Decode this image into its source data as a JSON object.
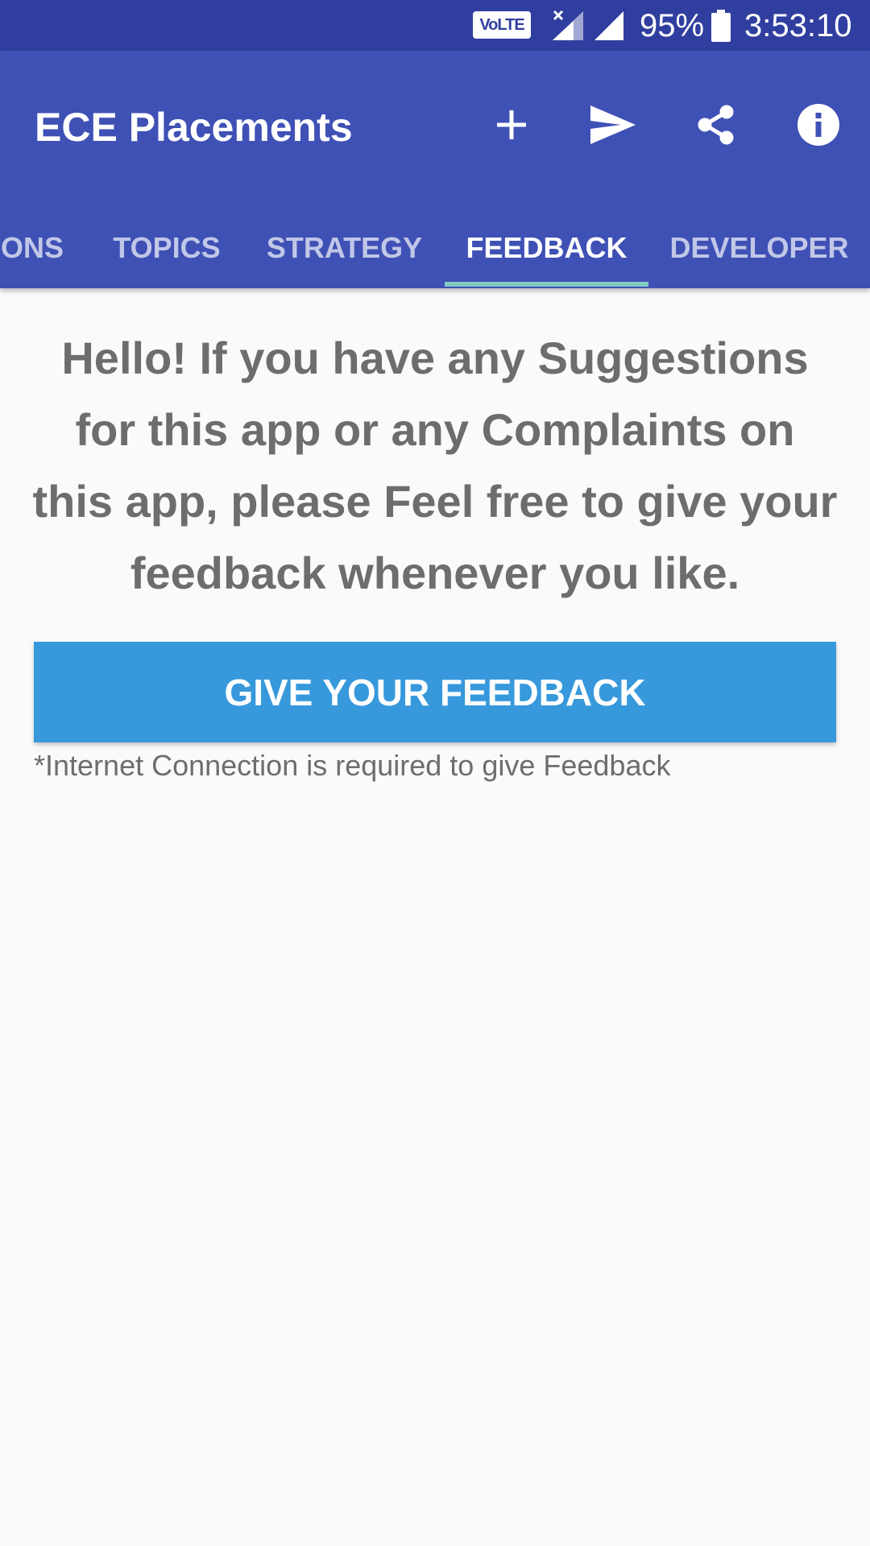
{
  "status_bar": {
    "volte": "VoLTE",
    "battery_percent": "95%",
    "time": "3:53:10",
    "icons": [
      "volte-icon",
      "signal-no-service-icon",
      "signal-icon",
      "battery-icon"
    ]
  },
  "app_bar": {
    "title": "ECE Placements",
    "actions": [
      "add-icon",
      "send-icon",
      "share-icon",
      "info-icon"
    ]
  },
  "tabs": [
    {
      "label": "ONS",
      "active": false
    },
    {
      "label": "TOPICS",
      "active": false
    },
    {
      "label": "STRATEGY",
      "active": false
    },
    {
      "label": "FEEDBACK",
      "active": true
    },
    {
      "label": "DEVELOPER",
      "active": false
    }
  ],
  "content": {
    "intro": "Hello! If you have any Suggestions for this app or any Complaints on this app, please Feel free to give your feedback whenever you like.",
    "button_label": "GIVE YOUR FEEDBACK",
    "note": "*Internet Connection is required to give Feedback"
  },
  "colors": {
    "status_bar": "#303f9f",
    "app_bar": "#3f51b5",
    "tab_indicator": "#80cbc4",
    "button": "#3799dc",
    "text_gray": "#6d6d6d",
    "background": "#fafafa"
  }
}
